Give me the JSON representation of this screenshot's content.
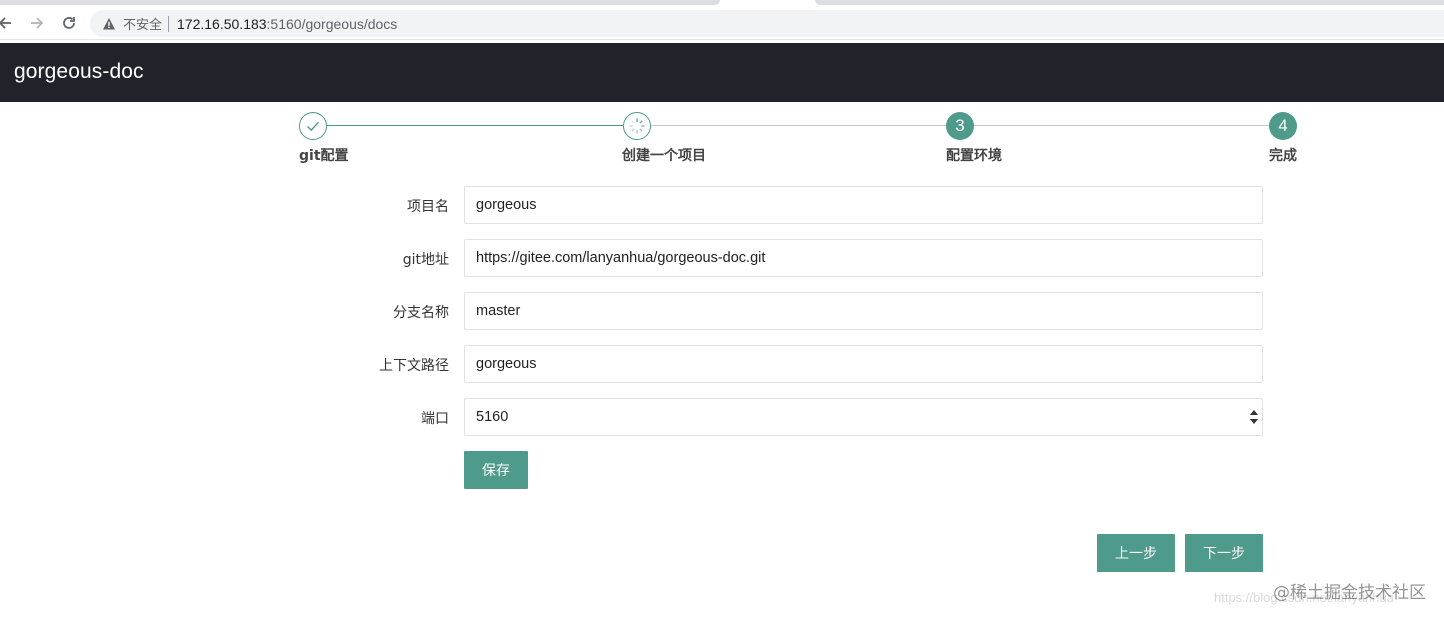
{
  "browser": {
    "security_label": "不安全",
    "url_host": "172.16.50.183",
    "url_path": ":5160/gorgeous/docs"
  },
  "app": {
    "title": "gorgeous-doc"
  },
  "steps": [
    {
      "label": "git配置",
      "number": "",
      "state": "done",
      "icon": "check-icon"
    },
    {
      "label": "创建一个项目",
      "number": "",
      "state": "in-progress",
      "icon": "spinner-icon"
    },
    {
      "label": "配置环境",
      "number": "3",
      "state": "pending"
    },
    {
      "label": "完成",
      "number": "4",
      "state": "pending"
    }
  ],
  "form": {
    "project_name": {
      "label": "项目名",
      "value": "gorgeous"
    },
    "git_url": {
      "label": "git地址",
      "value": "https://gitee.com/lanyanhua/gorgeous-doc.git"
    },
    "branch": {
      "label": "分支名称",
      "value": "master"
    },
    "context_path": {
      "label": "上下文路径",
      "value": "gorgeous"
    },
    "port": {
      "label": "端口",
      "value": "5160"
    },
    "save_label": "保存"
  },
  "nav": {
    "prev_label": "上一步",
    "next_label": "下一步"
  },
  "watermark": {
    "text": "@稀土掘金技术社区",
    "sub": "https://blog.csdn.net/lanyanhua"
  },
  "colors": {
    "accent": "#4e9a8b",
    "header_bg": "#20232a"
  }
}
